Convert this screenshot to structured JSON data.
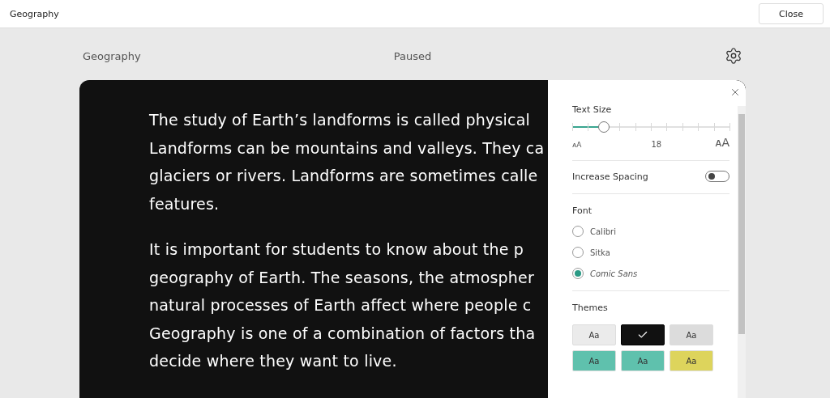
{
  "window": {
    "title": "Geography",
    "close_button": "Close"
  },
  "header": {
    "title": "Geography",
    "status": "Paused"
  },
  "reader": {
    "paragraphs": [
      {
        "lines": [
          "The study of Earth’s landforms is called physical",
          "Landforms can be mountains and valleys. They ca",
          "glaciers or rivers. Landforms are sometimes calle",
          "features."
        ]
      },
      {
        "lines": [
          "It is important for students to know about the p",
          "geography of Earth. The seasons, the atmospher",
          "natural processes of Earth affect where people c",
          "Geography is one of a combination of factors tha",
          "decide where they want to live."
        ]
      }
    ]
  },
  "settings": {
    "text_size": {
      "label": "Text Size",
      "level": 0.2,
      "small_glyph": "ᴀA",
      "value": "18",
      "large_glyph": "ᴀA"
    },
    "spacing": {
      "label": "Increase Spacing",
      "on": false
    },
    "font": {
      "label": "Font",
      "options": [
        {
          "label": "Calibri",
          "selected": false
        },
        {
          "label": "Sitka",
          "selected": false
        },
        {
          "label": "Comic Sans",
          "selected": true
        }
      ]
    },
    "themes": {
      "label": "Themes",
      "items": [
        {
          "label": "Aa",
          "selected": false,
          "color": "#ebebeb"
        },
        {
          "selected": true,
          "color": "#111111"
        },
        {
          "label": "Aa",
          "selected": false,
          "color": "#dcdcdc"
        },
        {
          "label": "Aa",
          "selected": false,
          "color": "#5fc1ad"
        },
        {
          "label": "Aa",
          "selected": false,
          "color": "#5fc1ad"
        },
        {
          "label": "Aa",
          "selected": false,
          "color": "#ddd45c"
        }
      ]
    }
  }
}
